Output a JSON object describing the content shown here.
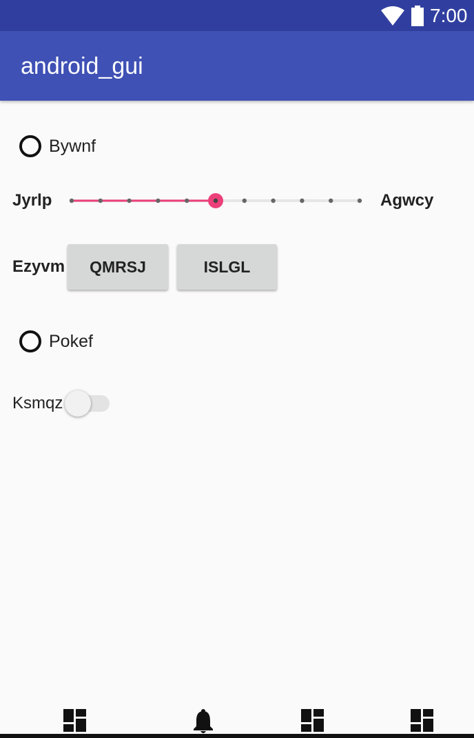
{
  "status_bar": {
    "time": "7:00",
    "icons": [
      "wifi-icon",
      "battery-icon"
    ]
  },
  "app_bar": {
    "title": "android_gui"
  },
  "radio_1": {
    "label": "Bywnf",
    "checked": false
  },
  "seekbar": {
    "left_label": "Jyrlp",
    "right_label": "Agwcy",
    "max": 10,
    "progress": 5,
    "accent_color": "#ec407a"
  },
  "button_row": {
    "label": "Ezyvm",
    "buttons": [
      {
        "label": "QMRSJ"
      },
      {
        "label": "ISLGL"
      }
    ]
  },
  "radio_2": {
    "label": "Pokef",
    "checked": false
  },
  "switch": {
    "label": "Ksmqz",
    "on": false
  },
  "bottom_nav": {
    "items": [
      "dashboard-icon",
      "bell-icon",
      "dashboard-icon",
      "dashboard-icon"
    ]
  },
  "colors": {
    "status_bar": "#303f9f",
    "app_bar": "#3f51b5",
    "background": "#fafafa",
    "button": "#d6d7d7"
  }
}
